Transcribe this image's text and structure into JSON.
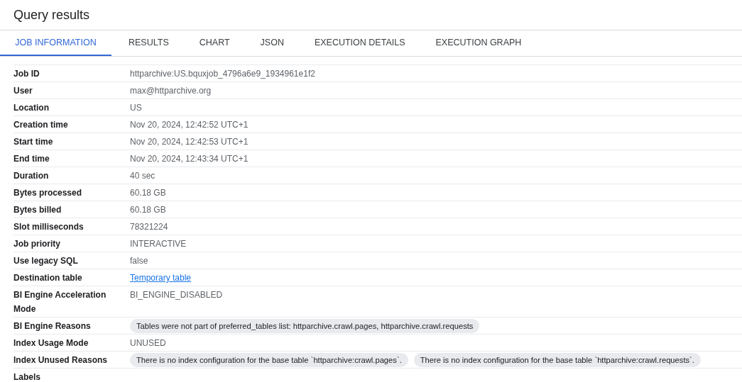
{
  "title": "Query results",
  "tabs": [
    {
      "label": "JOB INFORMATION",
      "selected": true
    },
    {
      "label": "RESULTS",
      "selected": false
    },
    {
      "label": "CHART",
      "selected": false
    },
    {
      "label": "JSON",
      "selected": false
    },
    {
      "label": "EXECUTION DETAILS",
      "selected": false
    },
    {
      "label": "EXECUTION GRAPH",
      "selected": false
    }
  ],
  "rows": [
    {
      "label": "Job ID",
      "kind": "text",
      "value": "httparchive:US.bquxjob_4796a6e9_1934961e1f2"
    },
    {
      "label": "User",
      "kind": "text",
      "value": "max@httparchive.org"
    },
    {
      "label": "Location",
      "kind": "text",
      "value": "US"
    },
    {
      "label": "Creation time",
      "kind": "text",
      "value": "Nov 20, 2024, 12:42:52 UTC+1"
    },
    {
      "label": "Start time",
      "kind": "text",
      "value": "Nov 20, 2024, 12:42:53 UTC+1"
    },
    {
      "label": "End time",
      "kind": "text",
      "value": "Nov 20, 2024, 12:43:34 UTC+1"
    },
    {
      "label": "Duration",
      "kind": "text",
      "value": "40 sec"
    },
    {
      "label": "Bytes processed",
      "kind": "text",
      "value": "60.18 GB"
    },
    {
      "label": "Bytes billed",
      "kind": "text",
      "value": "60.18 GB"
    },
    {
      "label": "Slot milliseconds",
      "kind": "text",
      "value": "78321224"
    },
    {
      "label": "Job priority",
      "kind": "text",
      "value": "INTERACTIVE"
    },
    {
      "label": "Use legacy SQL",
      "kind": "text",
      "value": "false"
    },
    {
      "label": "Destination table",
      "kind": "link",
      "value": "Temporary table"
    },
    {
      "label": "BI Engine Acceleration Mode",
      "kind": "text",
      "value": "BI_ENGINE_DISABLED"
    },
    {
      "label": "BI Engine Reasons",
      "kind": "chips",
      "chips": [
        "Tables were not part of preferred_tables list: httparchive.crawl.pages, httparchive.crawl.requests"
      ]
    },
    {
      "label": "Index Usage Mode",
      "kind": "text",
      "value": "UNUSED"
    },
    {
      "label": "Index Unused Reasons",
      "kind": "chips",
      "chips": [
        "There is no index configuration for the base table `httparchive:crawl.pages`.",
        "There is no index configuration for the base table `httparchive:crawl.requests`."
      ]
    },
    {
      "label": "Labels",
      "kind": "empty"
    }
  ]
}
